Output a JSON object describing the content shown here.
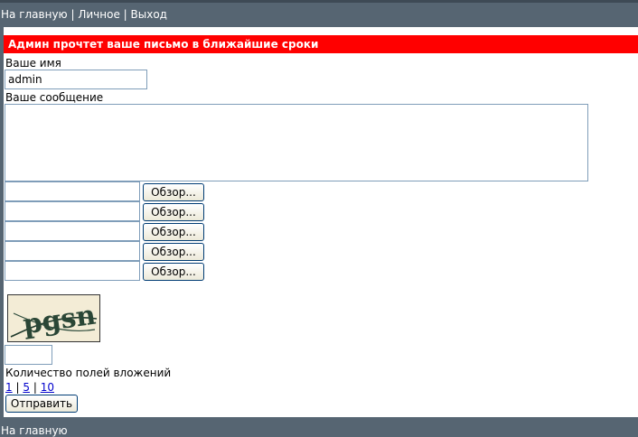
{
  "nav": {
    "home": "На главную",
    "personal": "Личное",
    "logout": "Выход",
    "separator": "|"
  },
  "form": {
    "alert": "Админ прочтет ваше письмо в ближайшие сроки",
    "name_label": "Ваше имя",
    "name_value": "admin",
    "message_label": "Ваше сообщение",
    "message_value": "",
    "browse_labels": [
      "Обзор...",
      "Обзор...",
      "Обзор...",
      "Обзор...",
      "Обзор..."
    ],
    "captcha_text": "pgsn",
    "captcha_input_value": "",
    "attachments_label": "Количество полей вложений",
    "attachment_counts": [
      "1",
      "5",
      "10"
    ],
    "submit_label": "Отправить"
  },
  "footer": {
    "home": "На главную"
  },
  "colors": {
    "bar": "#566572",
    "alert_bg": "#ff0000"
  }
}
